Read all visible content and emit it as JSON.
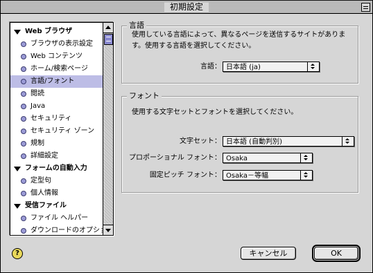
{
  "window": {
    "title": "初期設定"
  },
  "sidebar": {
    "items": [
      {
        "label": "Web ブラウザ",
        "kind": "cat"
      },
      {
        "label": "ブラウザの表示設定",
        "kind": "item"
      },
      {
        "label": "Web コンテンツ",
        "kind": "item"
      },
      {
        "label": "ホーム/検索ページ",
        "kind": "item"
      },
      {
        "label": "言語/フォント",
        "kind": "item",
        "selected": true
      },
      {
        "label": "閲読",
        "kind": "item"
      },
      {
        "label": "Java",
        "kind": "item"
      },
      {
        "label": "セキュリティ",
        "kind": "item"
      },
      {
        "label": "セキュリティ ゾーン",
        "kind": "item"
      },
      {
        "label": "規制",
        "kind": "item"
      },
      {
        "label": "詳細設定",
        "kind": "item"
      },
      {
        "label": "フォームの自動入力",
        "kind": "cat"
      },
      {
        "label": "定型句",
        "kind": "item"
      },
      {
        "label": "個人情報",
        "kind": "item"
      },
      {
        "label": "受信ファイル",
        "kind": "cat"
      },
      {
        "label": "ファイル ヘルパー",
        "kind": "item"
      },
      {
        "label": "ダウンロードのオプション",
        "kind": "item"
      }
    ]
  },
  "language": {
    "group_title": "言語",
    "description": "使用している言語によって、異なるページを送信するサイトがありま す。使用する言語を選択してください。",
    "field_label": "言語：",
    "value": "日本語 (ja)"
  },
  "font": {
    "group_title": "フォント",
    "description": "使用する文字セットとフォントを選択してください。",
    "charset_label": "文字セット：",
    "charset_value": "日本語 (自動判別)",
    "proportional_label": "プロポーショナル フォント：",
    "proportional_value": "Osaka",
    "fixed_label": "固定ピッチ フォント：",
    "fixed_value": "Osaka－等幅"
  },
  "buttons": {
    "cancel": "キャンセル",
    "ok": "OK"
  },
  "help": {
    "glyph": "?"
  },
  "colors": {
    "selection": "#bdbde6",
    "thumb": "#8a8ad0",
    "bullet": "#9b9bd6"
  }
}
